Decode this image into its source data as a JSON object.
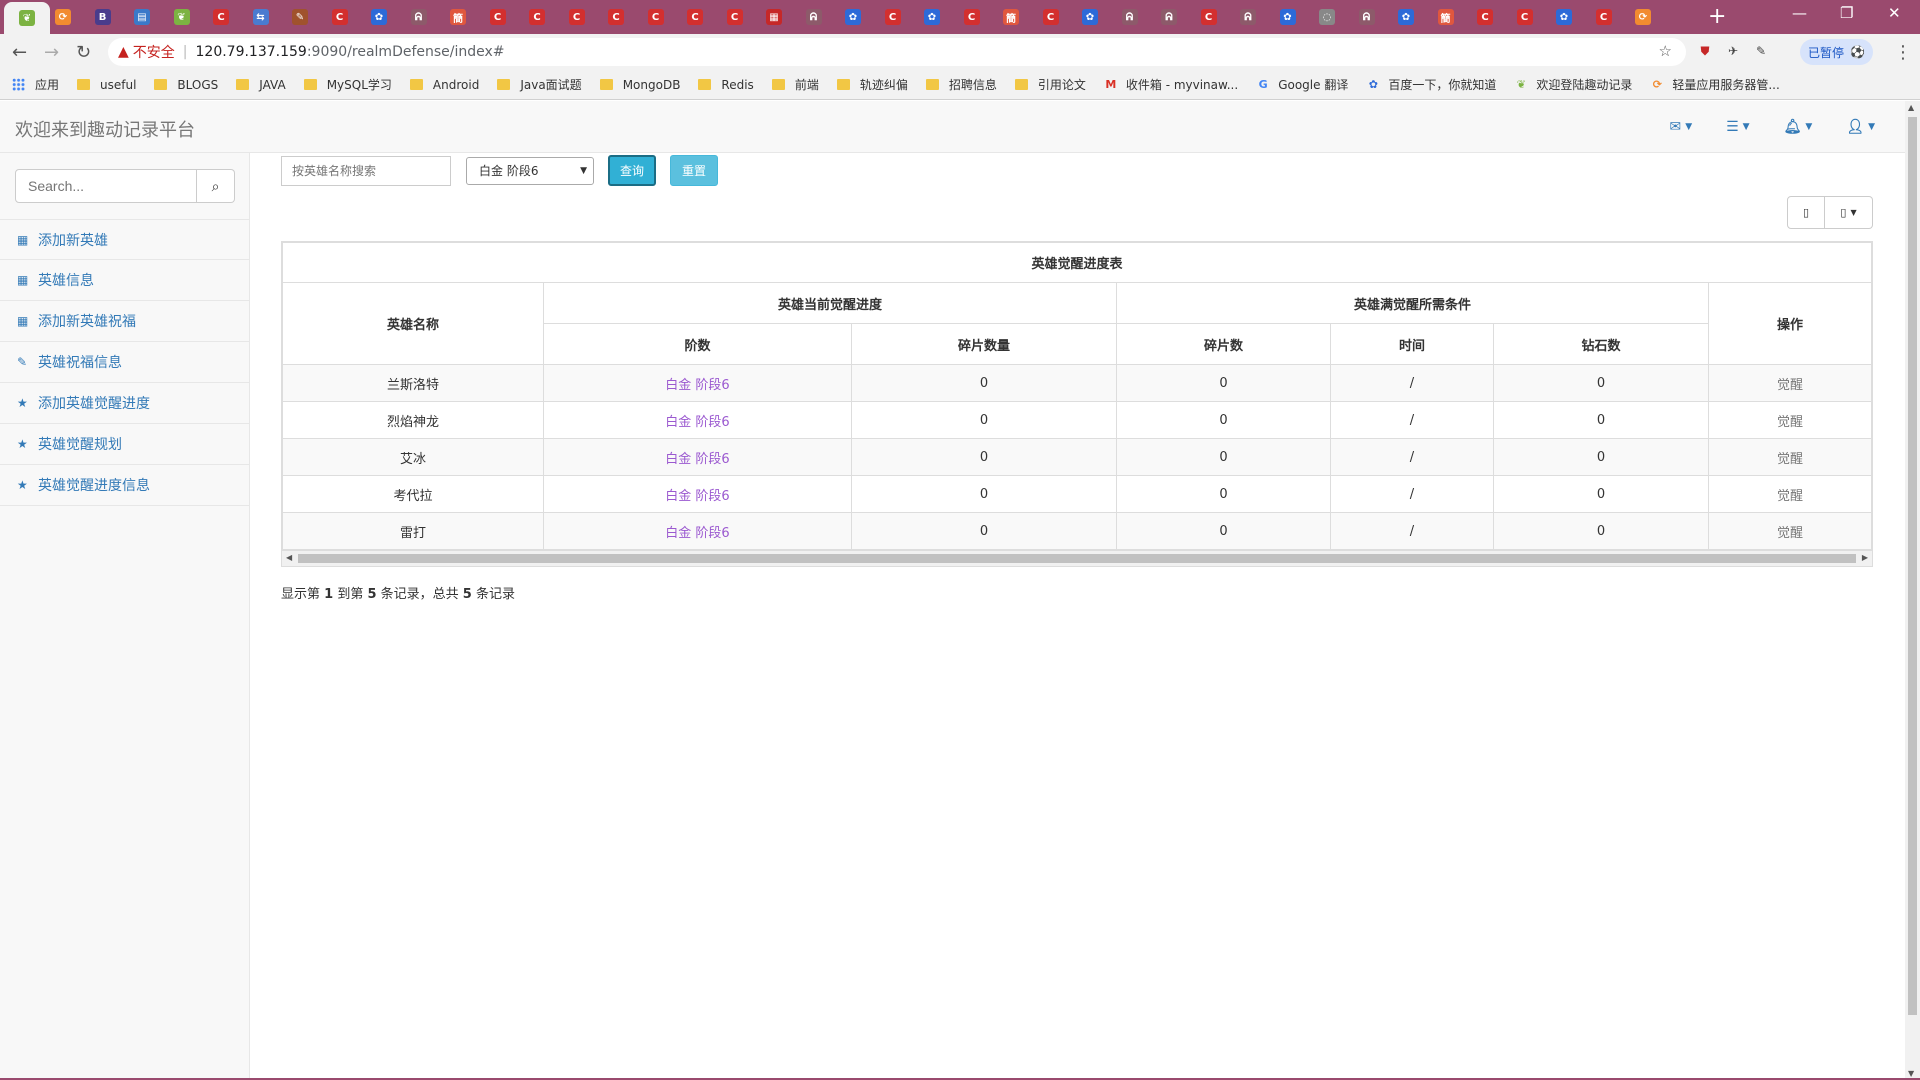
{
  "browser": {
    "security_label": "不安全",
    "url_host": "120.79.137.159",
    "url_path": ":9090/realmDefense/index#",
    "paused_label": "已暂停",
    "new_tab": "+",
    "bookmarks": [
      {
        "label": "应用",
        "icon": "apps-grid-icon"
      },
      {
        "label": "useful",
        "icon": "folder-icon"
      },
      {
        "label": "BLOGS",
        "icon": "folder-icon"
      },
      {
        "label": "JAVA",
        "icon": "folder-icon"
      },
      {
        "label": "MySQL学习",
        "icon": "folder-icon"
      },
      {
        "label": "Android",
        "icon": "folder-icon"
      },
      {
        "label": "Java面试题",
        "icon": "folder-icon"
      },
      {
        "label": "MongoDB",
        "icon": "folder-icon"
      },
      {
        "label": "Redis",
        "icon": "folder-icon"
      },
      {
        "label": "前端",
        "icon": "folder-icon"
      },
      {
        "label": "轨迹纠偏",
        "icon": "folder-icon"
      },
      {
        "label": "招聘信息",
        "icon": "folder-icon"
      },
      {
        "label": "引用论文",
        "icon": "folder-icon"
      },
      {
        "label": "收件箱 - myvinaw...",
        "icon": "gmail-icon"
      },
      {
        "label": "Google 翻译",
        "icon": "google-translate-icon"
      },
      {
        "label": "百度一下，你就知道",
        "icon": "baidu-icon"
      },
      {
        "label": "欢迎登陆趣动记录",
        "icon": "leaf-icon"
      },
      {
        "label": "轻量应用服务器管...",
        "icon": "aliyun-icon"
      }
    ]
  },
  "app": {
    "brand": "欢迎来到趣动记录平台",
    "search_placeholder": "Search...",
    "menu": [
      {
        "label": "添加新英雄",
        "icon": "table-icon"
      },
      {
        "label": "英雄信息",
        "icon": "table-icon"
      },
      {
        "label": "添加新英雄祝福",
        "icon": "table-icon"
      },
      {
        "label": "英雄祝福信息",
        "icon": "edit-icon"
      },
      {
        "label": "添加英雄觉醒进度",
        "icon": "star-icon"
      },
      {
        "label": "英雄觉醒规划",
        "icon": "star-icon"
      },
      {
        "label": "英雄觉醒进度信息",
        "icon": "star-icon"
      }
    ],
    "filter": {
      "name_placeholder": "按英雄名称搜索",
      "stage_selected": "白金 阶段6",
      "query_label": "查询",
      "reset_label": "重置"
    },
    "table": {
      "caption": "英雄觉醒进度表",
      "col_name": "英雄名称",
      "group_current": "英雄当前觉醒进度",
      "group_required": "英雄满觉醒所需条件",
      "col_action": "操作",
      "col_stage": "阶数",
      "col_fragments": "碎片数量",
      "col_req_fragments": "碎片数",
      "col_time": "时间",
      "col_diamonds": "钻石数",
      "rows": [
        {
          "name": "兰斯洛特",
          "stage": "白金 阶段6",
          "fragments": "0",
          "req_fragments": "0",
          "time": "/",
          "diamonds": "0",
          "action": "觉醒"
        },
        {
          "name": "烈焰神龙",
          "stage": "白金 阶段6",
          "fragments": "0",
          "req_fragments": "0",
          "time": "/",
          "diamonds": "0",
          "action": "觉醒"
        },
        {
          "name": "艾冰",
          "stage": "白金 阶段6",
          "fragments": "0",
          "req_fragments": "0",
          "time": "/",
          "diamonds": "0",
          "action": "觉醒"
        },
        {
          "name": "考代拉",
          "stage": "白金 阶段6",
          "fragments": "0",
          "req_fragments": "0",
          "time": "/",
          "diamonds": "0",
          "action": "觉醒"
        },
        {
          "name": "雷打",
          "stage": "白金 阶段6",
          "fragments": "0",
          "req_fragments": "0",
          "time": "/",
          "diamonds": "0",
          "action": "觉醒"
        }
      ]
    },
    "summary": {
      "prefix": "显示第 ",
      "from": "1",
      "mid1": " 到第 ",
      "to": "5",
      "mid2": " 条记录，总共 ",
      "total": "5",
      "suffix": " 条记录"
    }
  }
}
